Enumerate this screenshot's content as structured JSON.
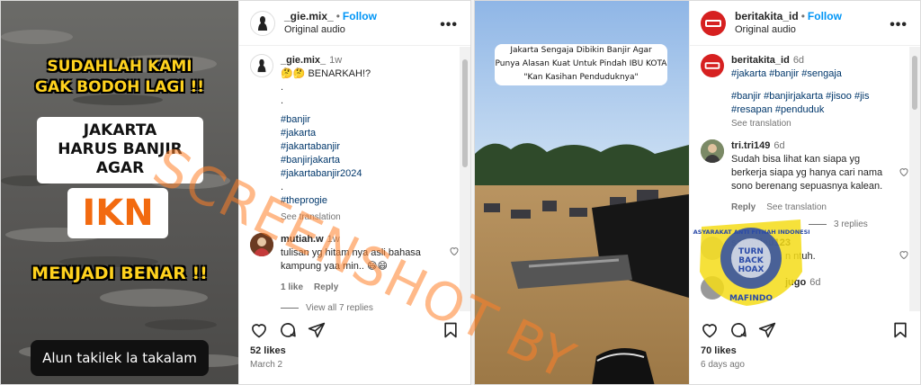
{
  "left_post": {
    "media": {
      "line1": "SUDAHLAH KAMI",
      "line2": "GAK BODOH LAGI !!",
      "box": [
        "JAKARTA",
        "HARUS BANJIR",
        "AGAR"
      ],
      "ikn": "IKN",
      "line3": "MENJADI BENAR !!",
      "bottom_caption": "Alun takilek la takalam"
    },
    "header": {
      "username": "_gie.mix_",
      "follow": "Follow",
      "audio": "Original audio"
    },
    "caption": {
      "username": "_gie.mix_",
      "time": "1w",
      "text": "🤔🤔 BENARKAH!?",
      "dots": [
        ".",
        "."
      ],
      "hashtags": [
        "#banjir",
        "#jakarta",
        "#jakartabanjir",
        "#banjirjakarta",
        "#jakartabanjir2024"
      ],
      "dot3": ".",
      "hashtag_last": "#theprogie",
      "see_translation": "See translation"
    },
    "comment": {
      "username": "mutiah.w",
      "time": "1w",
      "text": "tulisan yg hitam nya asli bahasa kampung yaa min.. 😄😄",
      "likes": "1 like",
      "reply": "Reply",
      "view_all": "View all 7 replies"
    },
    "likes": "52 likes",
    "date": "March 2"
  },
  "right_post": {
    "media": {
      "caption_lines": [
        "Jakarta Sengaja Dibikin Banjir Agar",
        "Punya Alasan Kuat Untuk Pindah IBU KOTA",
        "\"Kan Kasihan Penduduknya\""
      ]
    },
    "header": {
      "username": "beritakita_id",
      "follow": "Follow",
      "audio": "Original audio"
    },
    "caption": {
      "username": "beritakita_id",
      "time": "6d",
      "line1": "#jakarta #banjir #sengaja",
      "line2": "#banjir #banjirjakarta #jisoo #jis",
      "line3": "#resapan #penduduk",
      "see_translation": "See translation"
    },
    "comment1": {
      "username": "tri.tri149",
      "time": "6d",
      "text": "Sudah bisa lihat kan siapa yg berkerja siapa yg hanya cari nama sono berenang sepuasnya kalean.",
      "reply": "Reply",
      "see_translation": "See translation",
      "view_replies": "3 replies"
    },
    "comment2": {
      "username": "sahadieu123",
      "text": "n ntuh."
    },
    "comment3": {
      "username": "jugo",
      "time": "6d"
    },
    "likes": "70 likes",
    "date": "6 days ago"
  },
  "watermark": "SCREENSHOT BY",
  "seal": {
    "ring_text": "MASYARAKAT ANTI FITNAH INDONESIA",
    "bottom_text": "MAFINDO",
    "center_text": [
      "TURN",
      "BACK",
      "HOAX"
    ]
  },
  "colors": {
    "accent": "#0095f6",
    "yellow": "#ffd21e",
    "watermark": "#ff8028",
    "seal_yellow": "#f5dc18",
    "seal_blue": "#2a4aa8"
  }
}
